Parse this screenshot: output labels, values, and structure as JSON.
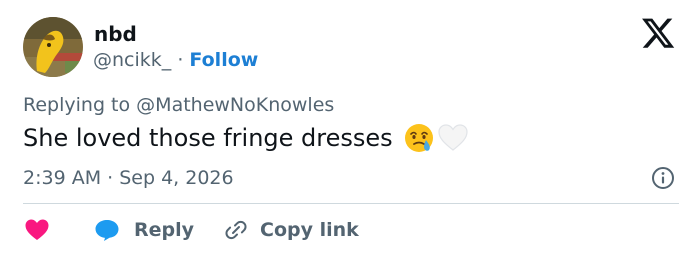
{
  "author": {
    "display_name": "nbd",
    "handle": "@ncikk_",
    "separator": "·",
    "follow_label": "Follow"
  },
  "replying_to": {
    "prefix": "Replying to",
    "mention": "@MathewNoKnowles"
  },
  "tweet": {
    "text": "She loved those fringe dresses",
    "emojis": [
      "face-holding-back-tears-icon",
      "white-heart-icon"
    ],
    "timestamp": "2:39 AM · Sep 4, 2026"
  },
  "actions": {
    "reply_label": "Reply",
    "copy_link_label": "Copy link"
  },
  "icons": {
    "brand": "x-logo-icon",
    "info": "info-icon",
    "like": "heart-icon",
    "reply": "speech-bubble-icon",
    "copy": "link-icon"
  },
  "colors": {
    "text_primary": "#0f1419",
    "text_secondary": "#536471",
    "follow_link": "#1d7fd4",
    "like_heart": "#f91880",
    "reply_bubble": "#1d9bf0",
    "divider": "#cfd9de"
  }
}
